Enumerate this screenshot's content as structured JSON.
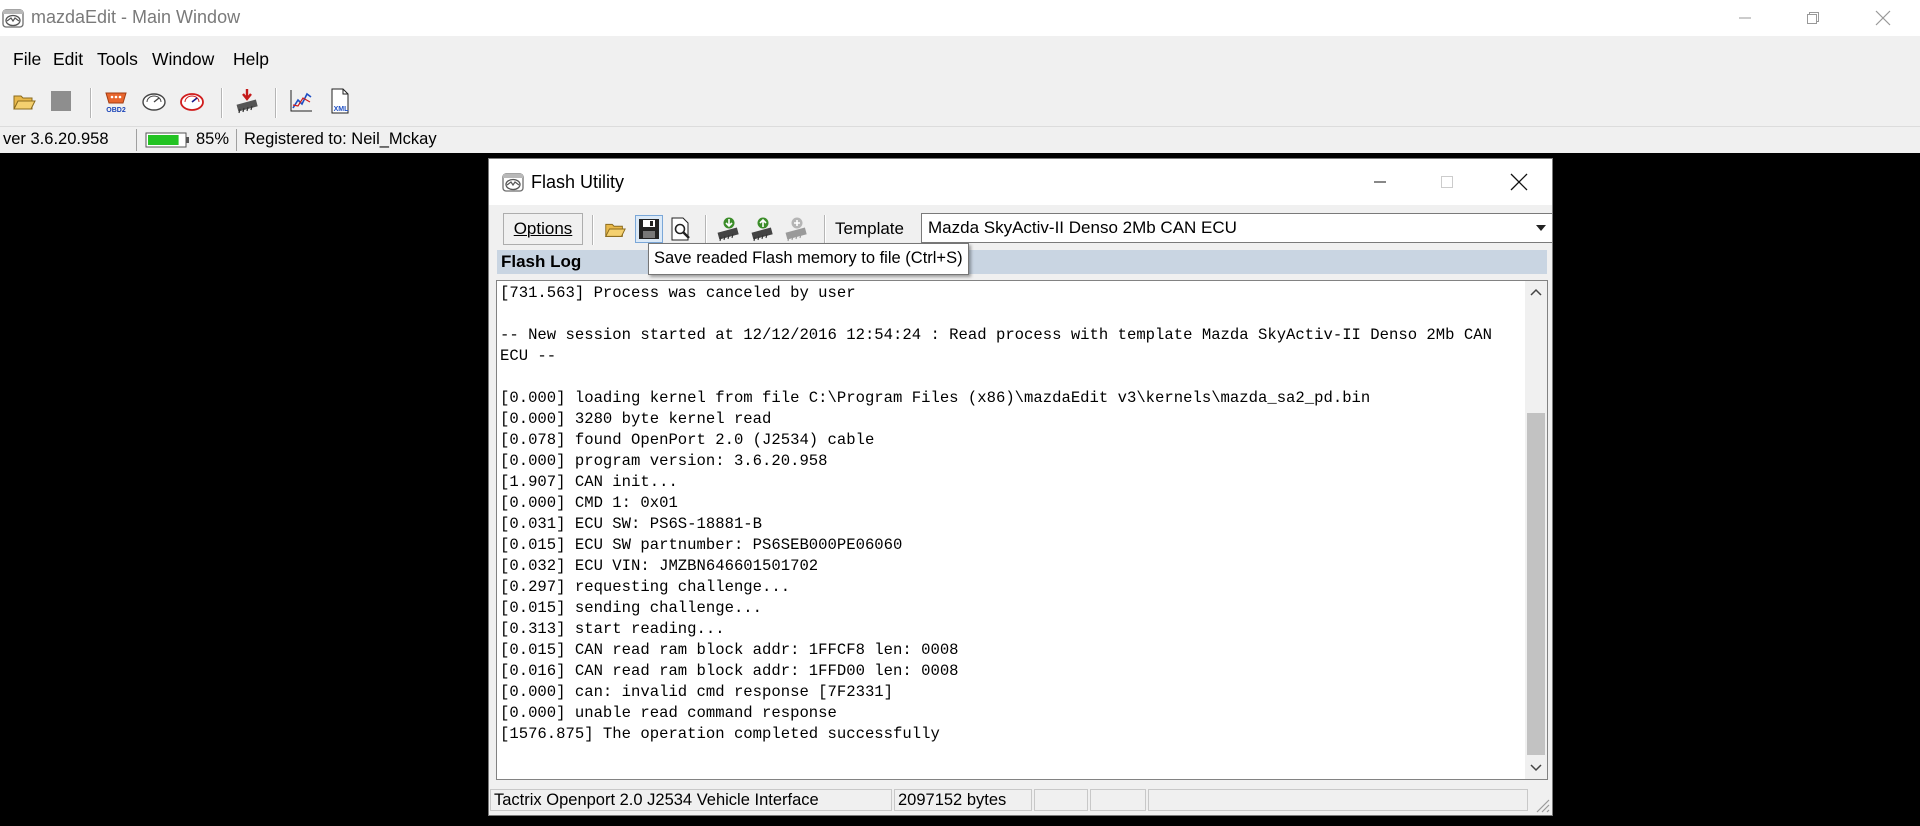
{
  "main_window": {
    "title": "mazdaEdit - Main Window",
    "menu": [
      "File",
      "Edit",
      "Tools",
      "Window",
      "Help"
    ],
    "toolbar_icons": [
      "open-folder-icon",
      "stop-icon",
      "obd2-icon",
      "gauge-icon",
      "gauge-red-icon",
      "flash-download-icon",
      "chart-icon",
      "xml-document-icon"
    ],
    "status": {
      "version": "ver 3.6.20.958",
      "battery_percent": "85%",
      "battery_level": 0.85,
      "registered": "Registered to: Neil_Mckay"
    }
  },
  "flash_utility": {
    "title": "Flash Utility",
    "options_label": "Options",
    "toolbar_icons": [
      "open-folder-icon",
      "save-icon",
      "print-preview-icon",
      "read-ecu-icon",
      "write-ecu-icon",
      "compare-ecu-icon"
    ],
    "template_label": "Template",
    "template_value": "Mazda SkyActiv-II Denso 2Mb CAN ECU",
    "log_header": "Flash Log",
    "tooltip": "Save readed Flash memory to file (Ctrl+S)",
    "log_text": "[731.563] Process was canceled by user\n\n-- New session started at 12/12/2016 12:54:24 : Read process with template Mazda SkyActiv-II Denso 2Mb CAN ECU --\n\n[0.000] loading kernel from file C:\\Program Files (x86)\\mazdaEdit v3\\kernels\\mazda_sa2_pd.bin\n[0.000] 3280 byte kernel read\n[0.078] found OpenPort 2.0 (J2534) cable\n[0.000] program version: 3.6.20.958\n[1.907] CAN init...\n[0.000] CMD 1: 0x01\n[0.031] ECU SW: PS6S-18881-B\n[0.015] ECU SW partnumber: PS6SEB000PE06060\n[0.032] ECU VIN: JMZBN646601501702\n[0.297] requesting challenge...\n[0.015] sending challenge...\n[0.313] start reading...\n[0.015] CAN read ram block addr: 1FFCF8 len: 0008\n[0.016] CAN read ram block addr: 1FFD00 len: 0008\n[0.000] can: invalid cmd response [7F2331]\n[0.000] unable read command response\n[1576.875] The operation completed successfully",
    "status": {
      "interface": "Tactrix Openport 2.0 J2534 Vehicle Interface",
      "size": "2097152 bytes"
    }
  },
  "colors": {
    "log_header_bg": "#c9d5e2",
    "battery_green": "#22c322"
  }
}
